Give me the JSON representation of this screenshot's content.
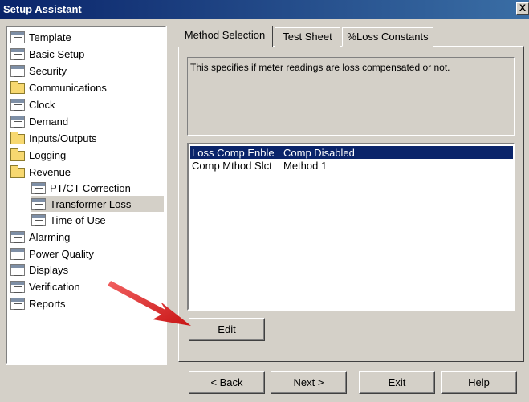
{
  "window": {
    "title": "Setup Assistant",
    "close_glyph": "X"
  },
  "tree": {
    "items": [
      {
        "label": "Template",
        "icon": "doc-icon"
      },
      {
        "label": "Basic Setup",
        "icon": "doc-icon"
      },
      {
        "label": "Security",
        "icon": "doc-icon"
      },
      {
        "label": "Communications",
        "icon": "folder-icon"
      },
      {
        "label": "Clock",
        "icon": "doc-icon"
      },
      {
        "label": "Demand",
        "icon": "doc-icon"
      },
      {
        "label": "Inputs/Outputs",
        "icon": "folder-icon"
      },
      {
        "label": "Logging",
        "icon": "folder-icon"
      },
      {
        "label": "Revenue",
        "icon": "folder-icon"
      },
      {
        "label": "PT/CT Correction",
        "icon": "doc-icon"
      },
      {
        "label": "Transformer Loss",
        "icon": "doc-icon",
        "selected": true
      },
      {
        "label": "Time of Use",
        "icon": "doc-icon"
      },
      {
        "label": "Alarming",
        "icon": "doc-icon"
      },
      {
        "label": "Power Quality",
        "icon": "doc-icon"
      },
      {
        "label": "Displays",
        "icon": "doc-icon"
      },
      {
        "label": "Verification",
        "icon": "doc-icon"
      },
      {
        "label": "Reports",
        "icon": "doc-icon"
      }
    ]
  },
  "tabs": [
    "Method Selection",
    "Test Sheet",
    "%Loss Constants"
  ],
  "description": "This specifies if meter readings are loss compensated or not.",
  "parameters": [
    {
      "name": "Loss Comp Enble",
      "value": "Comp Disabled",
      "selected": true
    },
    {
      "name": "Comp Mthod Slct",
      "value": "Method 1",
      "selected": false
    }
  ],
  "buttons": {
    "edit": "Edit",
    "back": "< Back",
    "next": "Next >",
    "exit": "Exit",
    "help": "Help"
  },
  "colors": {
    "title_bar": "#0a246a",
    "selection": "#0a246a",
    "annotation_arrow": "#e02020"
  }
}
